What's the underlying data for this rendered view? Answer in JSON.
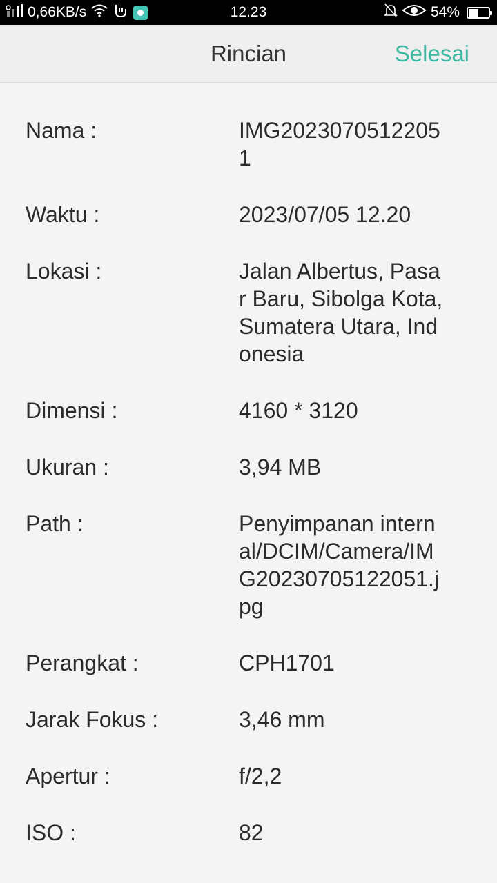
{
  "status_bar": {
    "network_speed": "0,66KB/s",
    "time": "12.23",
    "battery": "54%",
    "battery_level": 0.54,
    "icons": [
      "signal-icon",
      "wifi-icon",
      "gesture-icon",
      "app-notification-icon",
      "mute-icon",
      "eye-icon",
      "battery-icon"
    ]
  },
  "header": {
    "title": "Rincian",
    "done_label": "Selesai",
    "accent_color": "#3db8a3"
  },
  "details": [
    {
      "label": "Nama :",
      "value": "IMG20230705122051"
    },
    {
      "label": "Waktu :",
      "value": "2023/07/05 12.20"
    },
    {
      "label": "Lokasi :",
      "value": "Jalan Albertus, Pasar Baru, Sibolga Kota, Sumatera Utara, Indonesia"
    },
    {
      "label": "Dimensi :",
      "value": "4160 * 3120"
    },
    {
      "label": "Ukuran :",
      "value": "3,94 MB"
    },
    {
      "label": "Path :",
      "value": "Penyimpanan internal/DCIM/Camera/IMG20230705122051.jpg"
    },
    {
      "label": "Perangkat :",
      "value": "CPH1701"
    },
    {
      "label": "Jarak Fokus :",
      "value": "3,46 mm"
    },
    {
      "label": "Apertur :",
      "value": "f/2,2"
    },
    {
      "label": "ISO :",
      "value": "82"
    }
  ]
}
